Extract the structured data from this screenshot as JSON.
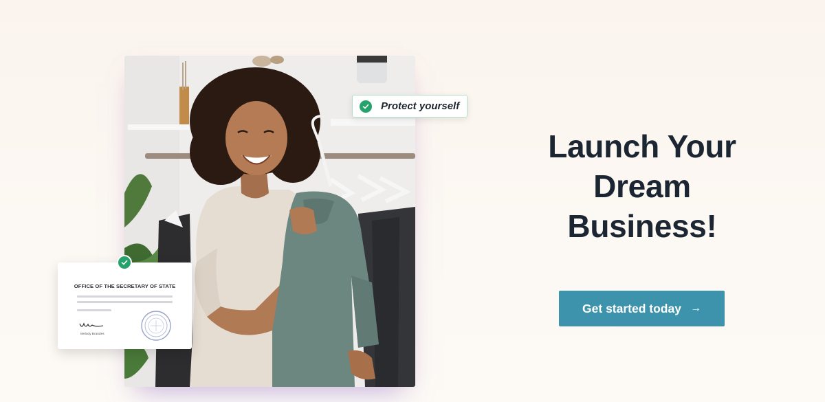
{
  "hero": {
    "image_alt": "Smiling woman holding a green sweater on a hanger in a clothing boutique"
  },
  "badges": {
    "protect": {
      "label": "Protect yourself",
      "icon": "check-icon",
      "color": "#26a26c"
    }
  },
  "certificate": {
    "title": "OFFICE OF THE SECRETARY OF STATE",
    "signer": "Melody Brandes",
    "seal_icon": "seal-icon",
    "check_icon": "check-icon"
  },
  "headline": {
    "lines": [
      "Launch Your",
      "Dream",
      "Business!"
    ]
  },
  "cta": {
    "label": "Get started today",
    "arrow": "→",
    "color": "#3d93ab"
  },
  "colors": {
    "accent_green": "#26a26c",
    "cta_teal": "#3d93ab",
    "headline": "#1c2532",
    "background": "#fbf6f0"
  }
}
